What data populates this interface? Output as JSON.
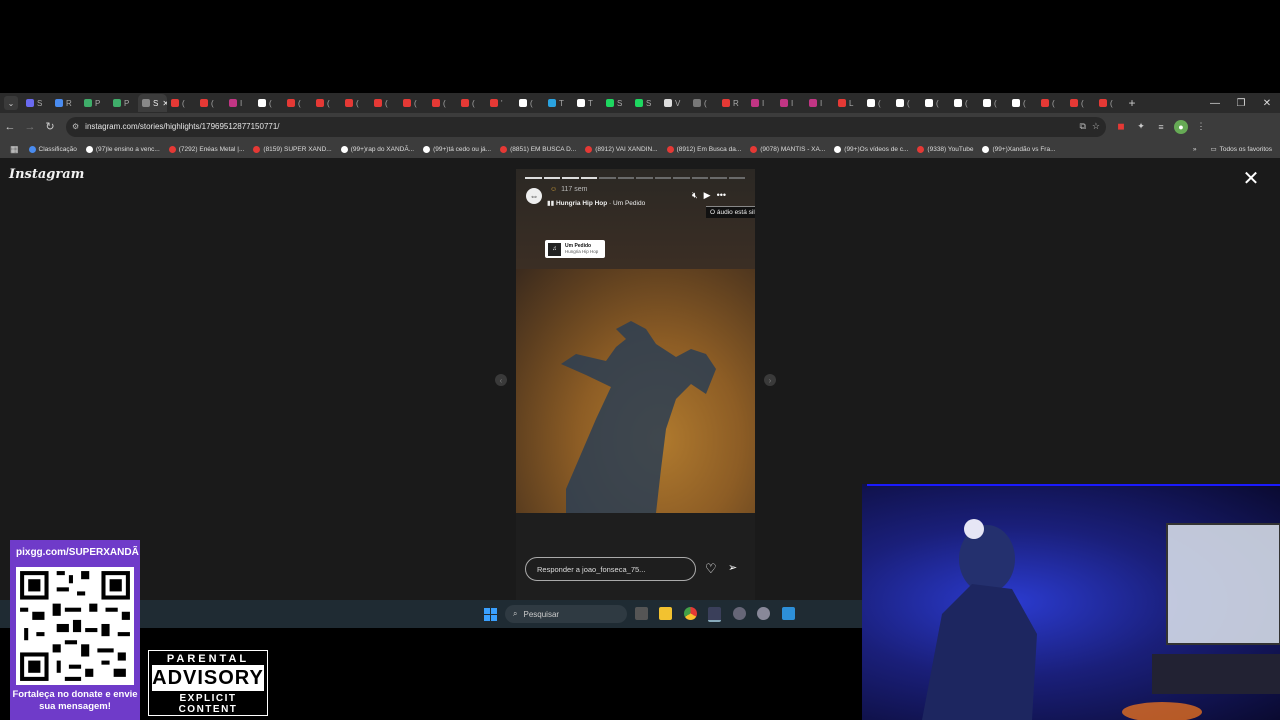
{
  "browser": {
    "tabs": [
      {
        "label": "S",
        "color": "#6a6af0"
      },
      {
        "label": "R",
        "color": "#4a8cf0"
      },
      {
        "label": "P",
        "color": "#3fae6a"
      },
      {
        "label": "P",
        "color": "#3fae6a"
      },
      {
        "label": "S",
        "color": "#888888",
        "active": true
      },
      {
        "label": "(",
        "color": "#e53935"
      },
      {
        "label": "(",
        "color": "#e53935"
      },
      {
        "label": "I",
        "color": "#c13584"
      },
      {
        "label": "(",
        "color": "#ffffff"
      },
      {
        "label": "(",
        "color": "#e53935"
      },
      {
        "label": "(",
        "color": "#e53935"
      },
      {
        "label": "(",
        "color": "#e53935"
      },
      {
        "label": "(",
        "color": "#e53935"
      },
      {
        "label": "(",
        "color": "#e53935"
      },
      {
        "label": "(",
        "color": "#e53935"
      },
      {
        "label": "(",
        "color": "#e53935"
      },
      {
        "label": "'",
        "color": "#e53935"
      },
      {
        "label": "(",
        "color": "#ffffff"
      },
      {
        "label": "T",
        "color": "#2aa3e0"
      },
      {
        "label": "T",
        "color": "#ffffff"
      },
      {
        "label": "S",
        "color": "#1ed760"
      },
      {
        "label": "S",
        "color": "#1ed760"
      },
      {
        "label": "V",
        "color": "#dddddd"
      },
      {
        "label": "(",
        "color": "#777777"
      },
      {
        "label": "R",
        "color": "#e53935"
      },
      {
        "label": "I",
        "color": "#c13584"
      },
      {
        "label": "I",
        "color": "#c13584"
      },
      {
        "label": "I",
        "color": "#c13584"
      },
      {
        "label": "L",
        "color": "#e53935"
      },
      {
        "label": "(",
        "color": "#ffffff"
      },
      {
        "label": "(",
        "color": "#ffffff"
      },
      {
        "label": "(",
        "color": "#ffffff"
      },
      {
        "label": "(",
        "color": "#ffffff"
      },
      {
        "label": "(",
        "color": "#ffffff"
      },
      {
        "label": "(",
        "color": "#ffffff"
      },
      {
        "label": "(",
        "color": "#e53935"
      },
      {
        "label": "(",
        "color": "#e53935"
      },
      {
        "label": "(",
        "color": "#e53935"
      }
    ],
    "url": "instagram.com/stories/highlights/17969512877150771/",
    "bookmarks": [
      {
        "label": "Classificação",
        "color": "#4a8cf0"
      },
      {
        "label": "(97)le ensino a venc...",
        "color": "#ffffff"
      },
      {
        "label": "(7292) Enéas Metal |...",
        "color": "#e53935"
      },
      {
        "label": "(8159) SUPER XAND...",
        "color": "#e53935"
      },
      {
        "label": "(99+)rap do XANDÃ...",
        "color": "#ffffff"
      },
      {
        "label": "(99+)tá cedo ou já...",
        "color": "#ffffff"
      },
      {
        "label": "(8851) EM BUSCA D...",
        "color": "#e53935"
      },
      {
        "label": "(8912) VAI XANDIN...",
        "color": "#e53935"
      },
      {
        "label": "(8912) Em Busca da...",
        "color": "#e53935"
      },
      {
        "label": "(9078) MANTIS - XA...",
        "color": "#e53935"
      },
      {
        "label": "(99+)Os vídeos de c...",
        "color": "#ffffff"
      },
      {
        "label": "(9338) YouTube",
        "color": "#e53935"
      },
      {
        "label": "(99+)Xandão vs Fra...",
        "color": "#ffffff"
      }
    ],
    "all_bookmarks": "Todos os favoritos"
  },
  "instagram": {
    "logo": "Instagram",
    "story": {
      "time_ago": "117 sem",
      "song_artist": "Hungria Hip Hop",
      "song_sep": " · ",
      "song_title": "Um Pedido",
      "tooltip": "O áudio está silenciado",
      "sticker_title": "Um Pedido",
      "sticker_artist": "Hungria Hip Hop",
      "reply_placeholder": "Responder a joao_fonseca_75...",
      "progress_total": 12,
      "progress_done": 4
    }
  },
  "taskbar": {
    "search_label": "Pesquisar"
  },
  "overlay": {
    "qr_url": "pixgg.com/SUPERXANDÃ",
    "qr_message": "Fortaleça no donate e envie sua mensagem!",
    "advisory_line1": "PARENTAL",
    "advisory_line2": "ADVISORY",
    "advisory_line3": "EXPLICIT CONTENT"
  }
}
